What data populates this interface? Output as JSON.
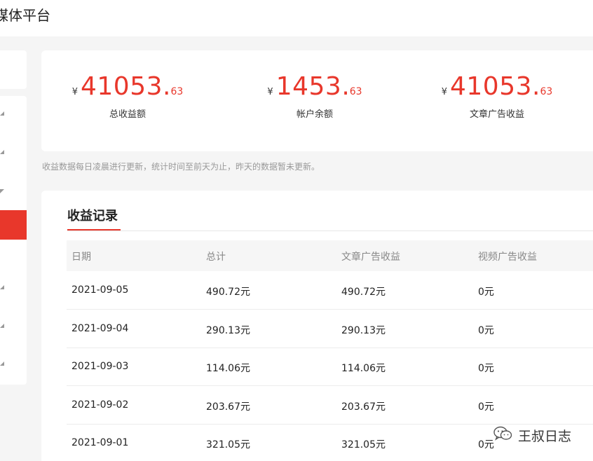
{
  "header": {
    "title": "媒体平台"
  },
  "stats": [
    {
      "currency": "¥",
      "integer": "41053",
      "decimal": "63",
      "label": "总收益额"
    },
    {
      "currency": "¥",
      "integer": "1453",
      "decimal": "63",
      "label": "帐户余额"
    },
    {
      "currency": "¥",
      "integer": "41053",
      "decimal": "63",
      "label": "文章广告收益"
    }
  ],
  "note": "收益数据每日凌晨进行更新，统计时间至前天为止，昨天的数据暂未更新。",
  "records": {
    "title": "收益记录",
    "columns": [
      "日期",
      "总计",
      "文章广告收益",
      "视频广告收益"
    ],
    "rows": [
      [
        "2021-09-05",
        "490.72元",
        "490.72元",
        "0元"
      ],
      [
        "2021-09-04",
        "290.13元",
        "290.13元",
        "0元"
      ],
      [
        "2021-09-03",
        "114.06元",
        "114.06元",
        "0元"
      ],
      [
        "2021-09-02",
        "203.67元",
        "203.67元",
        "0元"
      ],
      [
        "2021-09-01",
        "321.05元",
        "321.05元",
        "0元"
      ]
    ]
  },
  "watermark": {
    "text": "王叔日志",
    "icon": "wechat-icon"
  },
  "colors": {
    "accent": "#e8372b",
    "background": "#f5f5f5",
    "card": "#ffffff"
  }
}
